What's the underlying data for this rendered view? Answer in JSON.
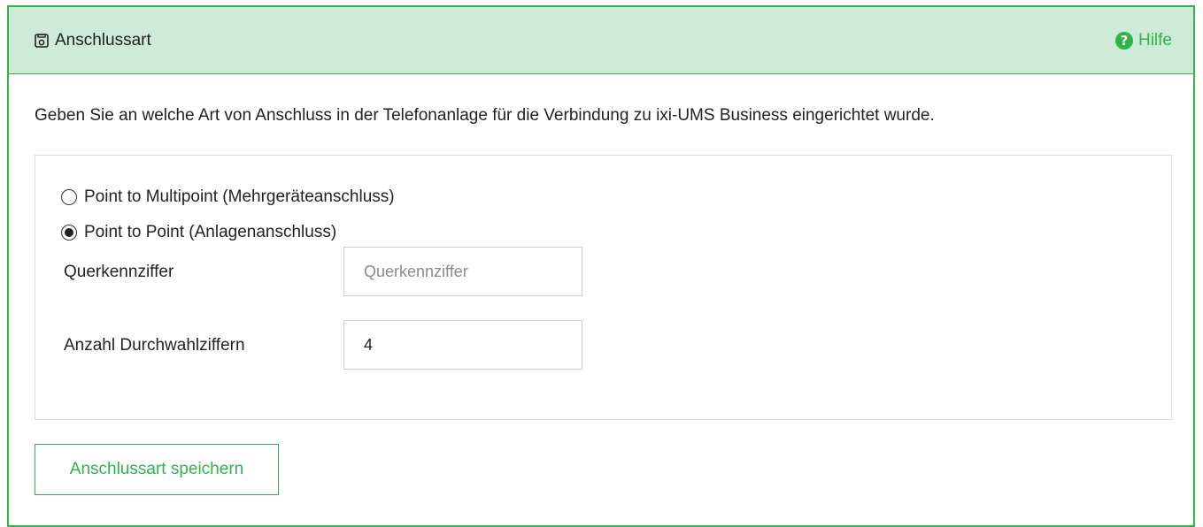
{
  "panel": {
    "title": "Anschlussart",
    "title_icon": "phone-plug-icon",
    "help_label": "Hilfe",
    "help_icon": "question-circle-icon"
  },
  "description": "Geben Sie an welche Art von Anschluss in der Telefonanlage für die Verbindung zu ixi-UMS Business eingerichtet wurde.",
  "options": [
    {
      "label": "Point to Multipoint (Mehrgeräteanschluss)",
      "selected": false
    },
    {
      "label": "Point to Point (Anlagenanschluss)",
      "selected": true
    }
  ],
  "fields": {
    "querkennziffer": {
      "label": "Querkennziffer",
      "value": "",
      "placeholder": "Querkennziffer"
    },
    "durchwahlziffern": {
      "label": "Anzahl Durchwahlziffern",
      "value": "4",
      "placeholder": ""
    }
  },
  "save_button_label": "Anschlussart speichern",
  "colors": {
    "accent": "#2fb34a",
    "header_bg": "#cdebd7",
    "border": "#d9d9d9"
  }
}
